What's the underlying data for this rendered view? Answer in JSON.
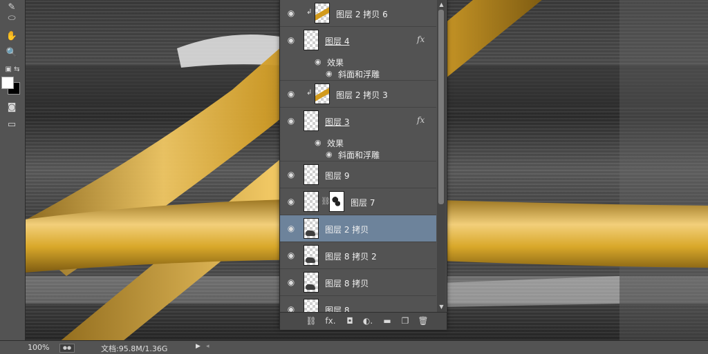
{
  "toolbar": {
    "tools": [
      {
        "name": "brush-tool",
        "glyph": "✎"
      },
      {
        "name": "ellipse-tool",
        "glyph": "⬭"
      },
      {
        "name": "hand-tool",
        "glyph": "✋"
      },
      {
        "name": "zoom-tool",
        "glyph": "🔍"
      },
      {
        "name": "quick-mask-tool",
        "glyph": "◙"
      },
      {
        "name": "screen-mode-tool",
        "glyph": "▭"
      }
    ],
    "foreground_color": "#ffffff",
    "background_color": "#000000"
  },
  "status": {
    "zoom": "100%",
    "doc_info": "文档:95.8M/1.36G"
  },
  "layers": [
    {
      "name": "图层 2 拷贝 6",
      "thumb": "gold",
      "clipped": true,
      "fx": false,
      "selected": false,
      "underline": false
    },
    {
      "name": "图层 4",
      "thumb": "empty",
      "clipped": false,
      "fx": true,
      "selected": false,
      "underline": true,
      "effects_label": "效果",
      "effects": [
        "斜面和浮雕"
      ]
    },
    {
      "name": "图层 2 拷贝 3",
      "thumb": "gold",
      "clipped": true,
      "fx": false,
      "selected": false,
      "underline": false
    },
    {
      "name": "图层 3",
      "thumb": "empty",
      "clipped": false,
      "fx": true,
      "selected": false,
      "underline": true,
      "effects_label": "效果",
      "effects": [
        "斜面和浮雕"
      ]
    },
    {
      "name": "图层 9",
      "thumb": "empty",
      "clipped": false,
      "fx": false,
      "selected": false,
      "underline": false
    },
    {
      "name": "图层 7",
      "thumb": "empty",
      "mask": true,
      "clipped": false,
      "fx": false,
      "selected": false,
      "underline": false
    },
    {
      "name": "图层 2 拷贝",
      "thumb": "dark",
      "clipped": false,
      "fx": false,
      "selected": true,
      "underline": false
    },
    {
      "name": "图层 8 拷贝 2",
      "thumb": "dark",
      "clipped": false,
      "fx": false,
      "selected": false,
      "underline": false
    },
    {
      "name": "图层 8 拷贝",
      "thumb": "dark",
      "clipped": false,
      "fx": false,
      "selected": false,
      "underline": false
    },
    {
      "name": "图层 8",
      "thumb": "empty",
      "clipped": false,
      "fx": false,
      "selected": false,
      "underline": false
    }
  ],
  "layers_footer": [
    {
      "name": "link-layers-icon",
      "glyph": "⛓"
    },
    {
      "name": "add-style-fx-icon",
      "glyph": "fx."
    },
    {
      "name": "add-mask-icon",
      "glyph": "◘"
    },
    {
      "name": "adjustment-layer-icon",
      "glyph": "◐."
    },
    {
      "name": "new-group-icon",
      "glyph": "▬"
    },
    {
      "name": "new-layer-icon",
      "glyph": "❐"
    },
    {
      "name": "delete-layer-icon",
      "glyph": "🗑"
    }
  ],
  "colors": {
    "tube_gold": "#d9a82a",
    "panel_bg": "#535353",
    "selected_row": "#6d839b"
  }
}
